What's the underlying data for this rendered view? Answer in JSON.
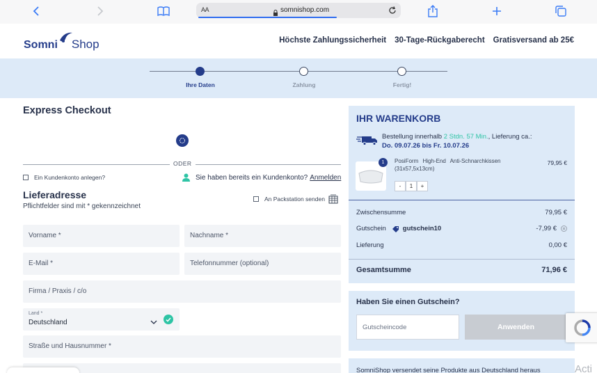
{
  "browser": {
    "aa_label": "AA",
    "url": "somnishop.com",
    "load_progress": 0.69
  },
  "header": {
    "logo_part1": "Somni",
    "logo_part2": "Shop",
    "trust_items": [
      "Höchste Zahlungssicherheit",
      "30-Tage-Rückgaberecht",
      "Gratisversand ab 25€"
    ]
  },
  "steps": [
    {
      "label": "Ihre Daten",
      "active": true
    },
    {
      "label": "Zahlung",
      "active": false
    },
    {
      "label": "Fertig!",
      "active": false
    }
  ],
  "checkout": {
    "express_title": "Express Checkout",
    "or_label": "ODER",
    "create_account_label": "Ein Kundenkonto anlegen?",
    "has_account_text": "Sie haben bereits ein Kundenkonto?",
    "login_link": "Anmelden",
    "address_title": "Lieferadresse",
    "required_note": "Pflichtfelder sind mit * gekennzeichnet",
    "packstation_label": "An Packstation senden"
  },
  "form": {
    "first_name_placeholder": "Vorname *",
    "last_name_placeholder": "Nachname *",
    "email_placeholder": "E-Mail *",
    "phone_placeholder": "Telefonnummer (optional)",
    "company_placeholder": "Firma / Praxis / c/o",
    "country_label": "Land *",
    "country_value": "Deutschland",
    "street_placeholder": "Straße und Hausnummer *"
  },
  "cart": {
    "title": "IHR WARENKORB",
    "delivery_prefix": "Bestellung innerhalb",
    "delivery_time": "2 Stdn. 57 Min.",
    "delivery_suffix": ", Lieferung ca.:",
    "delivery_dates": "Do. 09.07.26 bis Fr. 10.07.26",
    "product": {
      "name": "PosiForm High-End Anti-Schnarchkissen",
      "dims": "(31x57,5x13cm)",
      "price": "79,95 €",
      "quantity": "1",
      "badge": "1"
    },
    "subtotal_label": "Zwischensumme",
    "subtotal_value": "79,95 €",
    "voucher_label": "Gutschein",
    "voucher_code": "gutschein10",
    "voucher_value": "-7,99 €",
    "shipping_label": "Lieferung",
    "shipping_value": "0,00 €",
    "total_label": "Gesamtsumme",
    "total_value": "71,96 €"
  },
  "voucher_box": {
    "title": "Haben Sie einen Gutschein?",
    "input_placeholder": "Gutscheincode",
    "apply_label": "Anwenden"
  },
  "info_text": "SomniShop versendet seine Produkte aus Deutschland heraus",
  "overlay_text": "Acti",
  "colors": {
    "brand": "#243c8a",
    "accent_green": "#2ec4a5",
    "panel_bg": "#ddeaf8"
  }
}
